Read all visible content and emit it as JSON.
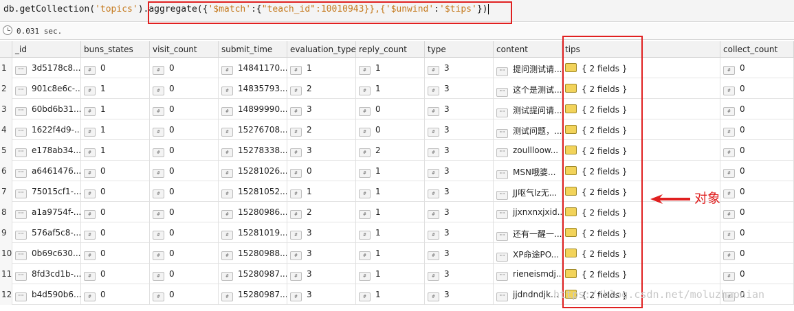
{
  "query": {
    "p1": "db.getCollection(",
    "p2": "'topics'",
    "p3": ").aggregate({",
    "p4": "'$match'",
    "p5": ":{",
    "p6": "\"teach_id\"",
    "p7": ":10010943}},{",
    "p8": "'$unwind'",
    "p9": ":",
    "p10": "'$tips'",
    "p11": "})"
  },
  "status": {
    "elapsed": "0.031 sec."
  },
  "columns": [
    "_id",
    "buns_states",
    "visit_count",
    "submit_time",
    "evaluation_type",
    "reply_count",
    "type",
    "content",
    "tips",
    "collect_count"
  ],
  "rows": [
    {
      "n": "1",
      "id": "3d5178c8...",
      "buns": "0",
      "visit": "0",
      "submit": "14841170...",
      "eval": "1",
      "reply": "1",
      "type": "3",
      "content": "提问测试请...",
      "tips": "{ 2 fields }",
      "collect": "0"
    },
    {
      "n": "2",
      "id": "901c8e6c-...",
      "buns": "1",
      "visit": "0",
      "submit": "14835793...",
      "eval": "2",
      "reply": "1",
      "type": "3",
      "content": "这个是测试...",
      "tips": "{ 2 fields }",
      "collect": "0"
    },
    {
      "n": "3",
      "id": "60bd6b31...",
      "buns": "1",
      "visit": "0",
      "submit": "14899990...",
      "eval": "3",
      "reply": "0",
      "type": "3",
      "content": "测试提问请...",
      "tips": "{ 2 fields }",
      "collect": "0"
    },
    {
      "n": "4",
      "id": "1622f4d9-...",
      "buns": "1",
      "visit": "0",
      "submit": "15276708...",
      "eval": "2",
      "reply": "0",
      "type": "3",
      "content": "测试问题，...",
      "tips": "{ 2 fields }",
      "collect": "0"
    },
    {
      "n": "5",
      "id": "e178ab34...",
      "buns": "1",
      "visit": "0",
      "submit": "15278338...",
      "eval": "3",
      "reply": "2",
      "type": "3",
      "content": "zoullloow...",
      "tips": "{ 2 fields }",
      "collect": "0"
    },
    {
      "n": "6",
      "id": "a6461476...",
      "buns": "0",
      "visit": "0",
      "submit": "15281026...",
      "eval": "0",
      "reply": "1",
      "type": "3",
      "content": "MSN哦婆...",
      "tips": "{ 2 fields }",
      "collect": "0"
    },
    {
      "n": "7",
      "id": "75015cf1-...",
      "buns": "0",
      "visit": "0",
      "submit": "15281052...",
      "eval": "1",
      "reply": "1",
      "type": "3",
      "content": "JJ呕气lz无...",
      "tips": "{ 2 fields }",
      "collect": "0"
    },
    {
      "n": "8",
      "id": "a1a9754f-...",
      "buns": "0",
      "visit": "0",
      "submit": "15280986...",
      "eval": "2",
      "reply": "1",
      "type": "3",
      "content": "jjxnxnxjxid...",
      "tips": "{ 2 fields }",
      "collect": "0"
    },
    {
      "n": "9",
      "id": "576af5c8-...",
      "buns": "0",
      "visit": "0",
      "submit": "15281019...",
      "eval": "3",
      "reply": "1",
      "type": "3",
      "content": "还有一醒一...",
      "tips": "{ 2 fields }",
      "collect": "0"
    },
    {
      "n": "10",
      "id": "0b69c630...",
      "buns": "0",
      "visit": "0",
      "submit": "15280988...",
      "eval": "3",
      "reply": "1",
      "type": "3",
      "content": "XP命途PO...",
      "tips": "{ 2 fields }",
      "collect": "0"
    },
    {
      "n": "11",
      "id": "8fd3cd1b-...",
      "buns": "0",
      "visit": "0",
      "submit": "15280987...",
      "eval": "3",
      "reply": "1",
      "type": "3",
      "content": "rieneismdj...",
      "tips": "{ 2 fields }",
      "collect": "0"
    },
    {
      "n": "12",
      "id": "b4d590b6...",
      "buns": "0",
      "visit": "0",
      "submit": "15280987...",
      "eval": "3",
      "reply": "1",
      "type": "3",
      "content": "jjdndndjk...",
      "tips": "{ 2 fields }",
      "collect": "0"
    }
  ],
  "annotation": {
    "label": "对象",
    "color": "#e02020"
  },
  "watermark": "https://blog.csdn.net/moluzhaonian"
}
